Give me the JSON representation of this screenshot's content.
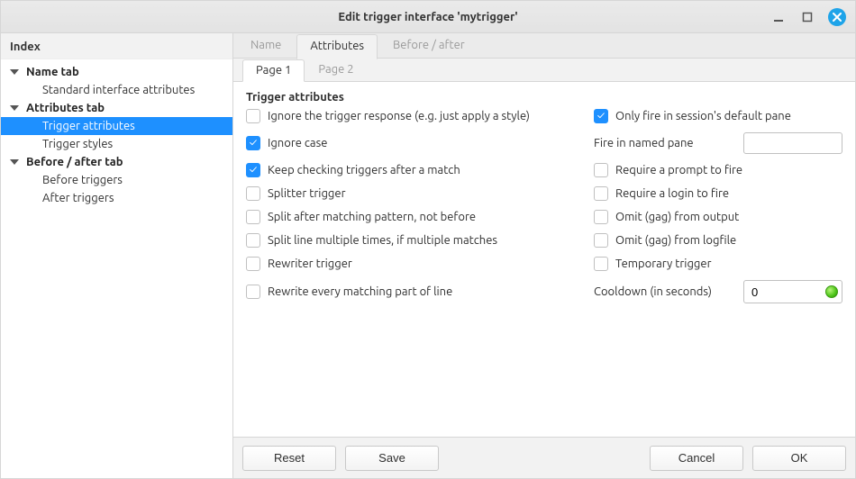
{
  "window": {
    "title": "Edit trigger interface 'mytrigger'"
  },
  "sidebar": {
    "header": "Index",
    "groups": [
      {
        "label": "Name tab",
        "items": [
          {
            "label": "Standard interface attributes",
            "selected": false
          }
        ]
      },
      {
        "label": "Attributes tab",
        "items": [
          {
            "label": "Trigger attributes",
            "selected": true
          },
          {
            "label": "Trigger styles",
            "selected": false
          }
        ]
      },
      {
        "label": "Before / after tab",
        "items": [
          {
            "label": "Before triggers",
            "selected": false
          },
          {
            "label": "After triggers",
            "selected": false
          }
        ]
      }
    ]
  },
  "tabs": {
    "main": [
      {
        "label": "Name",
        "active": false
      },
      {
        "label": "Attributes",
        "active": true
      },
      {
        "label": "Before / after",
        "active": false
      }
    ],
    "sub": [
      {
        "label": "Page 1",
        "active": true
      },
      {
        "label": "Page 2",
        "active": false
      }
    ]
  },
  "section": {
    "title": "Trigger attributes"
  },
  "left": {
    "ignore_response": {
      "label": "Ignore the trigger response (e.g. just apply a style)",
      "checked": false
    },
    "ignore_case": {
      "label": "Ignore case",
      "checked": true
    },
    "keep_checking": {
      "label": "Keep checking triggers after a match",
      "checked": true
    },
    "splitter": {
      "label": "Splitter trigger",
      "checked": false
    },
    "split_after": {
      "label": "Split after matching pattern, not before",
      "checked": false
    },
    "split_multiple": {
      "label": "Split line multiple times, if multiple matches",
      "checked": false
    },
    "rewriter": {
      "label": "Rewriter trigger",
      "checked": false
    },
    "rewrite_every": {
      "label": "Rewrite every matching part of line",
      "checked": false
    }
  },
  "right": {
    "only_default_pane": {
      "label": "Only fire in session's default pane",
      "checked": true
    },
    "named_pane": {
      "label": "Fire in named pane",
      "value": ""
    },
    "require_prompt": {
      "label": "Require a prompt to fire",
      "checked": false
    },
    "require_login": {
      "label": "Require a login to fire",
      "checked": false
    },
    "omit_output": {
      "label": "Omit (gag) from output",
      "checked": false
    },
    "omit_logfile": {
      "label": "Omit (gag) from logfile",
      "checked": false
    },
    "temporary": {
      "label": "Temporary trigger",
      "checked": false
    },
    "cooldown": {
      "label": "Cooldown (in seconds)",
      "value": "0"
    }
  },
  "buttons": {
    "reset": "Reset",
    "save": "Save",
    "cancel": "Cancel",
    "ok": "OK"
  }
}
